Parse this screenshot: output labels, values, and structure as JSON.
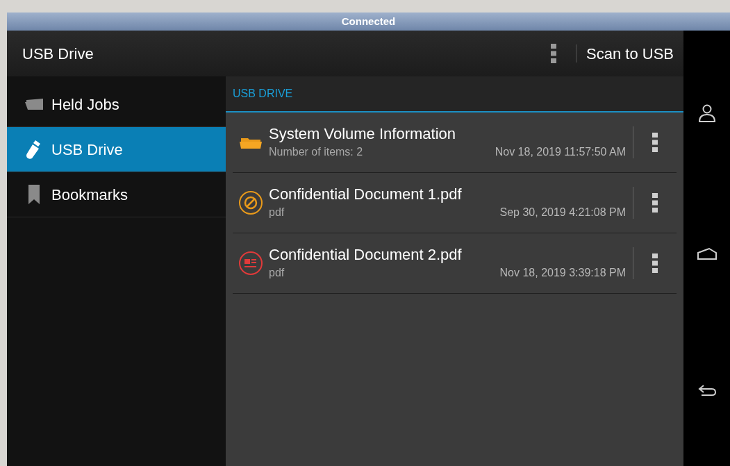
{
  "window": {
    "title": "Connected"
  },
  "header": {
    "title": "USB Drive",
    "action": "Scan to USB"
  },
  "sidebar": {
    "items": [
      {
        "label": "Held Jobs",
        "kind": "folder",
        "selected": false
      },
      {
        "label": "USB Drive",
        "kind": "usb",
        "selected": true
      },
      {
        "label": "Bookmarks",
        "kind": "bookmark",
        "selected": false
      }
    ]
  },
  "content": {
    "heading": "USB DRIVE",
    "files": [
      {
        "name": "System Volume Information",
        "detail": "Number of items: 2",
        "date": "Nov 18, 2019 11:57:50 AM",
        "kind": "folder"
      },
      {
        "name": "Confidential Document 1.pdf",
        "detail": "pdf",
        "date": "Sep 30, 2019 4:21:08 PM",
        "kind": "blocked"
      },
      {
        "name": "Confidential Document 2.pdf",
        "detail": "pdf",
        "date": "Nov 18, 2019 3:39:18 PM",
        "kind": "document"
      }
    ]
  }
}
